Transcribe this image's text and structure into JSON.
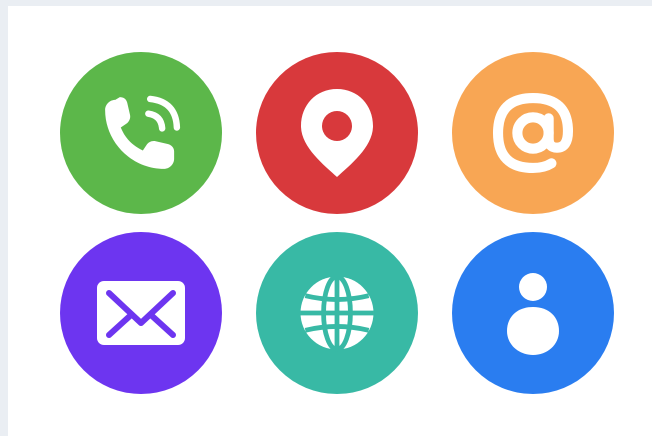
{
  "icons": [
    {
      "name": "phone-call-icon",
      "color": "#5cb74a"
    },
    {
      "name": "location-pin-icon",
      "color": "#d8393c"
    },
    {
      "name": "at-sign-icon",
      "color": "#f8a654"
    },
    {
      "name": "envelope-icon",
      "color": "#6d35f0"
    },
    {
      "name": "globe-icon",
      "color": "#38b9a5"
    },
    {
      "name": "user-icon",
      "color": "#2a7df0"
    }
  ]
}
